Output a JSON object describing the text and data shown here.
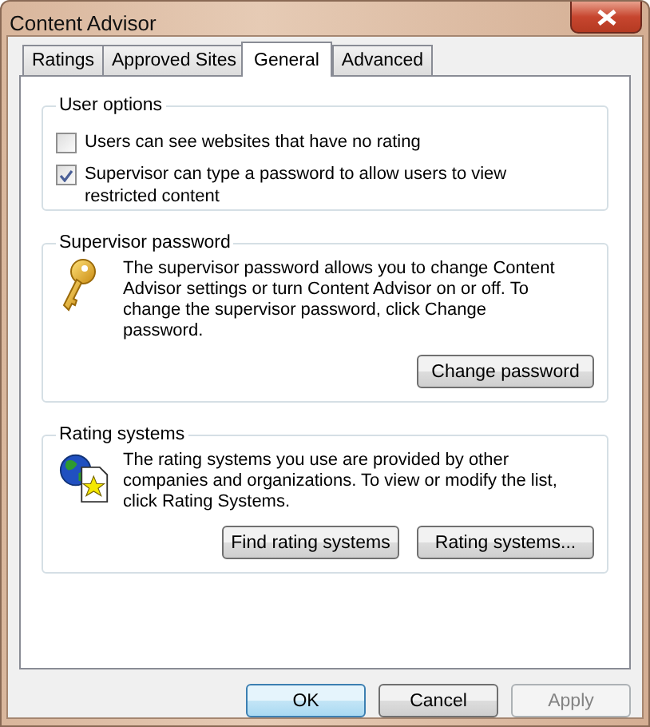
{
  "window": {
    "title": "Content Advisor"
  },
  "tabs": [
    {
      "label": "Ratings",
      "selected": false
    },
    {
      "label": "Approved Sites",
      "selected": false
    },
    {
      "label": "General",
      "selected": true
    },
    {
      "label": "Advanced",
      "selected": false
    }
  ],
  "groups": [
    {
      "kind": "options",
      "title": "User options",
      "options": [
        {
          "label": "Users can see websites that have no rating",
          "checked": false
        },
        {
          "label": "Supervisor can type a password to allow users to view restricted content",
          "checked": true
        }
      ]
    },
    {
      "kind": "info",
      "title": "Supervisor password",
      "text": "The supervisor password allows you to change Content Advisor settings or turn Content Advisor on or off. To change the supervisor password, click Change password.",
      "buttons": [
        "Change password"
      ]
    },
    {
      "kind": "info",
      "title": "Rating systems",
      "text": "The rating systems you use are provided by other companies and organizations. To view or modify the list, click Rating Systems.",
      "buttons": [
        "Find rating systems",
        "Rating systems..."
      ]
    }
  ],
  "buttons": [
    {
      "label": "OK",
      "default": true,
      "disabled": false
    },
    {
      "label": "Cancel",
      "default": false,
      "disabled": false
    },
    {
      "label": "Apply",
      "default": false,
      "disabled": true
    }
  ]
}
